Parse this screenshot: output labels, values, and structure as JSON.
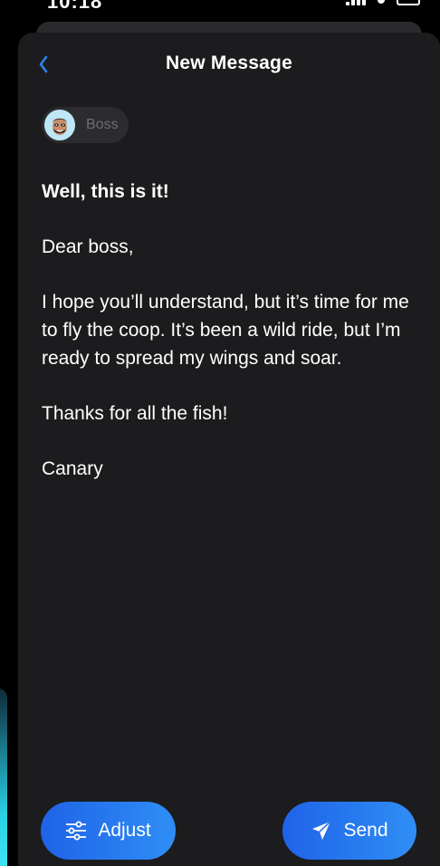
{
  "status_bar": {
    "time": "10:18"
  },
  "header": {
    "back_icon": "chevron-left-icon",
    "title": "New Message"
  },
  "recipient": {
    "name": "Boss",
    "avatar_icon": "memoji-avatar-icon"
  },
  "message": {
    "subject": "Well, this is it!",
    "paragraphs": [
      "Dear boss,",
      "I hope you’ll understand, but it’s time for me to fly the coop. It’s been a wild ride, but I’m ready to spread my wings and soar.",
      "Thanks for all the fish!",
      "Canary"
    ]
  },
  "actions": {
    "adjust_label": "Adjust",
    "adjust_icon": "sliders-icon",
    "send_label": "Send",
    "send_icon": "paper-plane-icon"
  },
  "colors": {
    "background": "#000000",
    "sheet": "#1c1c1e",
    "chip": "#2c2c2e",
    "accent": "#2f7df1",
    "back_chevron": "#2f80ed",
    "chip_text": "#6e6e73",
    "text": "#ffffff"
  }
}
